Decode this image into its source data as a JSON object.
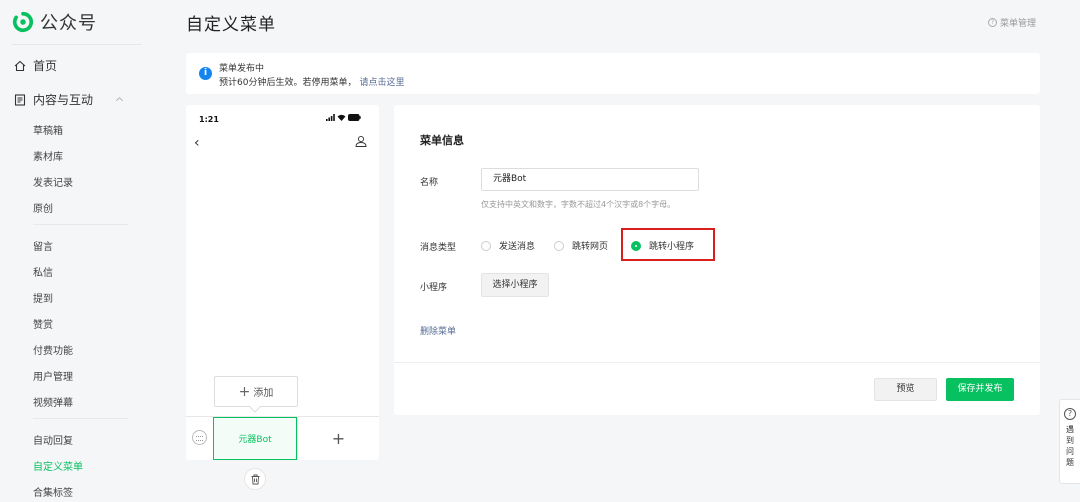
{
  "sidebar": {
    "brand": "公众号",
    "home": "首页",
    "content_section": "内容与互动",
    "items": [
      "草稿箱",
      "素材库",
      "发表记录",
      "原创",
      "留言",
      "私信",
      "提到",
      "赞赏",
      "付费功能",
      "用户管理",
      "视频弹幕",
      "自动回复",
      "自定义菜单",
      "合集标签"
    ],
    "active_item": "自定义菜单",
    "accent_color": "#07c160"
  },
  "header": {
    "title": "自定义菜单",
    "menu_manage": "菜单管理"
  },
  "notice": {
    "title": "菜单发布中",
    "text": "预计60分钟后生效。若停用菜单，",
    "link": "请点击这里",
    "icon": "info-icon"
  },
  "phone": {
    "time": "1:21",
    "add_label": "添加",
    "menu_item": "元器Bot",
    "plus": "+"
  },
  "editor": {
    "heading": "菜单信息",
    "name_label": "名称",
    "name_value": "元器Bot",
    "name_hint": "仅支持中英文和数字，字数不超过4个汉字或8个字母。",
    "msg_type_label": "消息类型",
    "options": [
      "发送消息",
      "跳转网页",
      "跳转小程序"
    ],
    "selected_option": "跳转小程序",
    "mini_program_label": "小程序",
    "choose_button": "选择小程序",
    "delete_link": "删除菜单",
    "preview_button": "预览",
    "save_button": "保存并发布",
    "highlight_color": "#d9201c"
  },
  "help": {
    "chars": [
      "遇",
      "到",
      "问",
      "题"
    ]
  }
}
